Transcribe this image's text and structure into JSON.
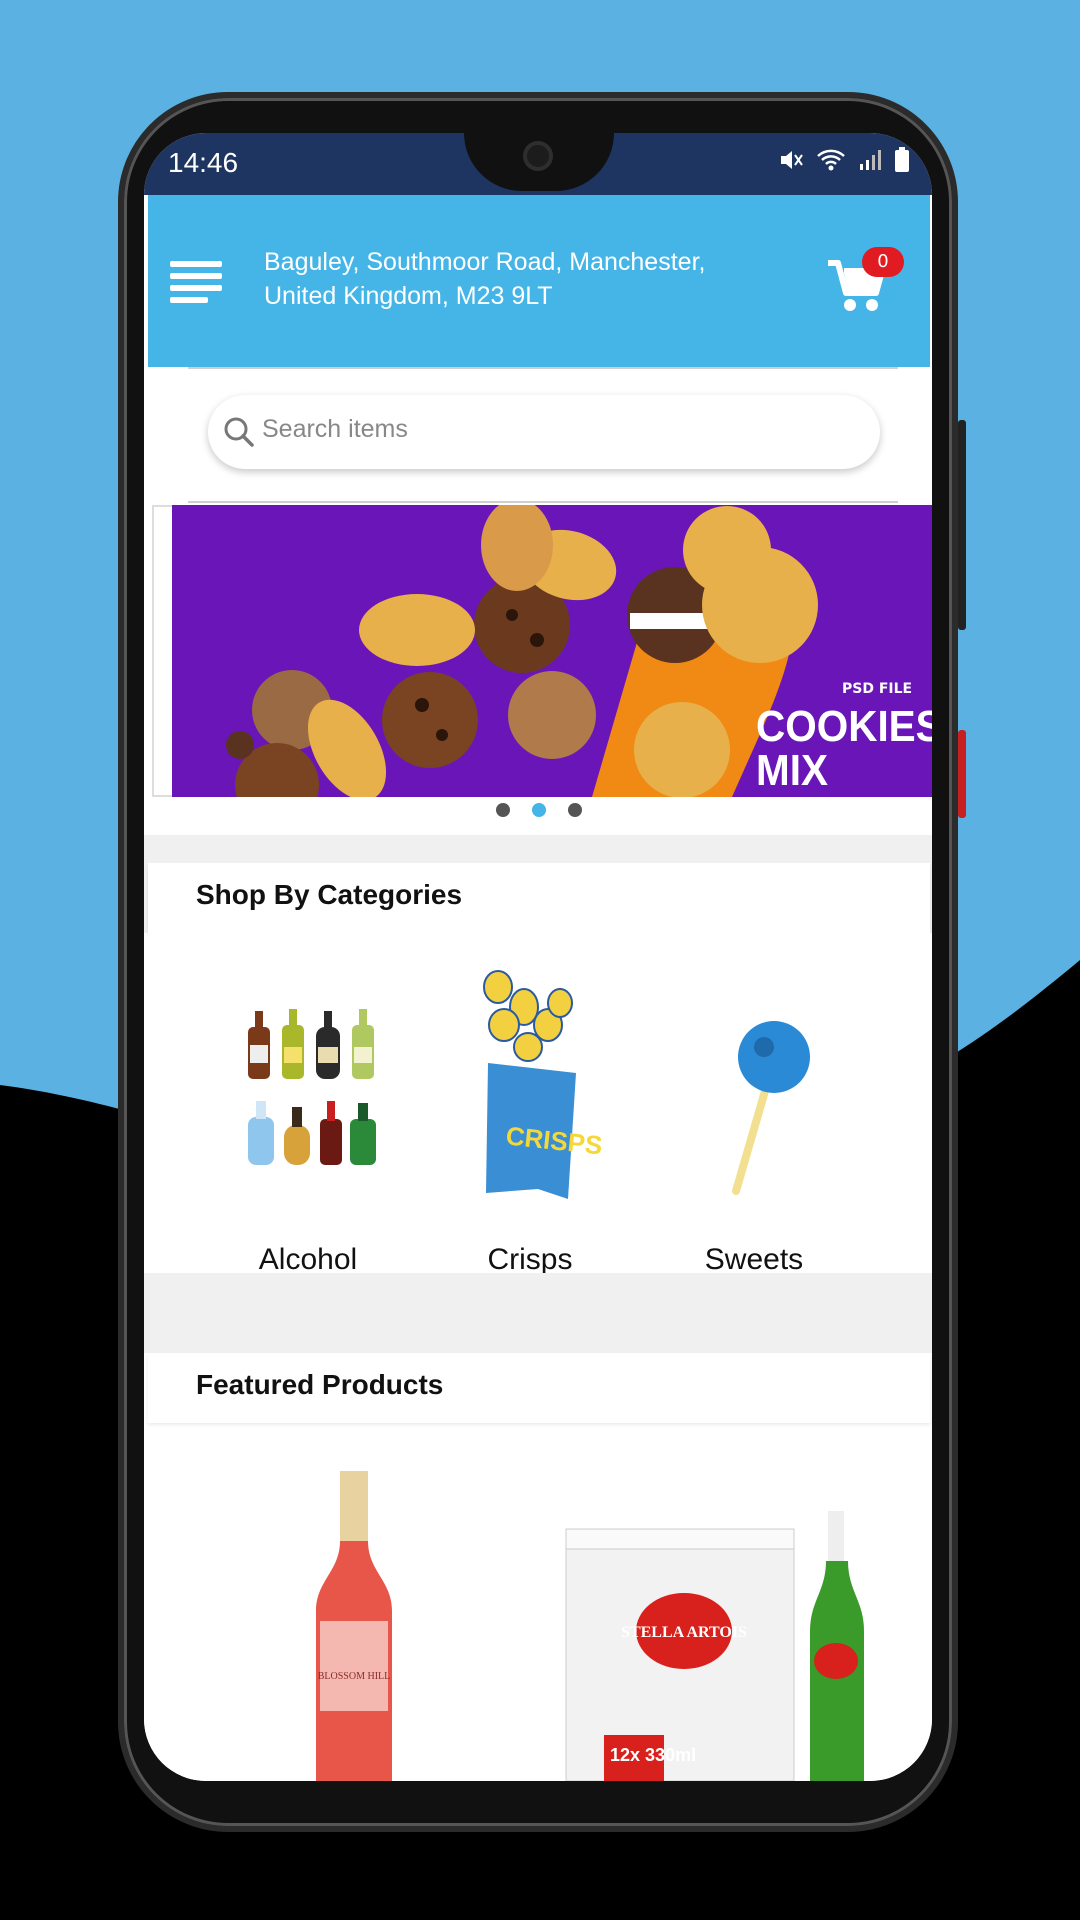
{
  "status_bar": {
    "time": "14:46"
  },
  "header": {
    "address": "Baguley, Southmoor Road, Manchester, United Kingdom, M23 9LT",
    "cart_count": "0"
  },
  "search": {
    "placeholder": "Search items"
  },
  "banner": {
    "brand": "PSD FILE",
    "title_line1": "COOKIES",
    "title_line2": "MIX",
    "slides_total": 3,
    "active_slide": 2
  },
  "categories": {
    "title": "Shop By Categories",
    "items": [
      {
        "label": "Alcohol",
        "icon": "alcohol-bottles-icon"
      },
      {
        "label": "Crisps",
        "icon": "crisps-bag-icon"
      },
      {
        "label": "Sweets",
        "icon": "lollipop-icon"
      }
    ]
  },
  "featured": {
    "title": "Featured Products",
    "products": [
      {
        "label_text": "BLOSSOM HILL",
        "icon": "rose-wine-bottle"
      },
      {
        "label_text": "STELLA ARTOIS",
        "icon": "beer-pack",
        "pack_text": "12x 330ml"
      }
    ]
  },
  "colors": {
    "accent": "#45b5e8",
    "status_bar": "#1d3560",
    "badge": "#e01b22",
    "banner_bg": "#6a15b8"
  }
}
